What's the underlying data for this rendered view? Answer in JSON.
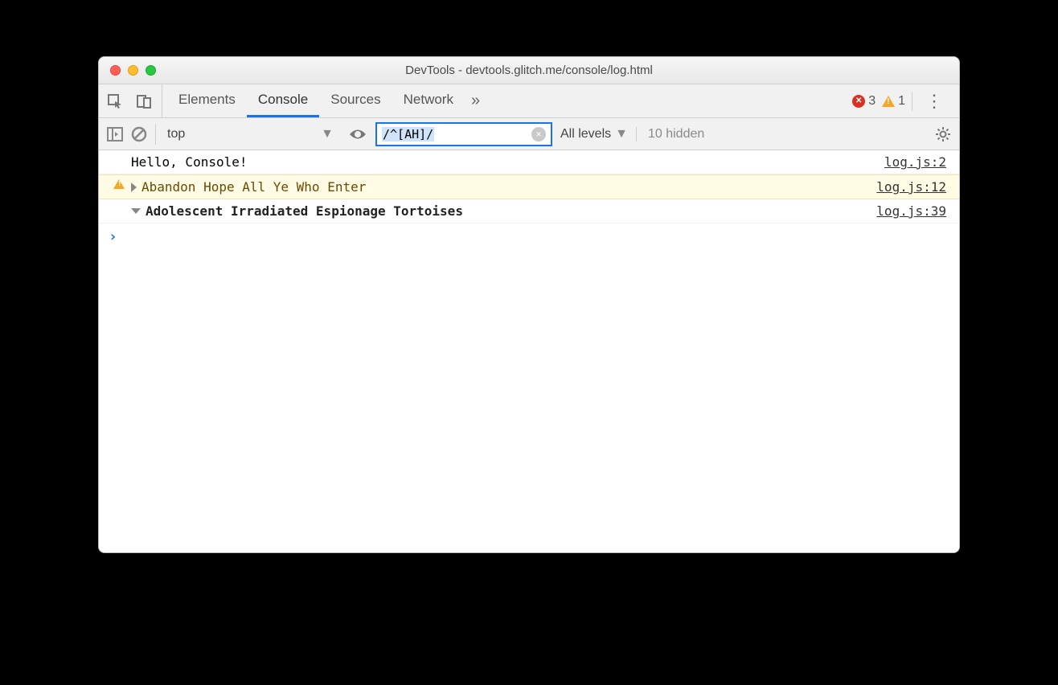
{
  "window": {
    "title": "DevTools - devtools.glitch.me/console/log.html"
  },
  "tabs": {
    "items": [
      "Elements",
      "Console",
      "Sources",
      "Network"
    ],
    "active_index": 1
  },
  "status": {
    "error_count": "3",
    "warning_count": "1"
  },
  "toolbar": {
    "context": "top",
    "filter_value": "/^[AH]/",
    "levels_label": "All levels",
    "hidden_label": "10 hidden"
  },
  "logs": [
    {
      "type": "log",
      "message": "Hello, Console!",
      "source": "log.js:2"
    },
    {
      "type": "warn",
      "message": "Abandon Hope All Ye Who Enter",
      "source": "log.js:12"
    },
    {
      "type": "group",
      "message": "Adolescent Irradiated Espionage Tortoises",
      "source": "log.js:39"
    }
  ],
  "prompt": "›"
}
